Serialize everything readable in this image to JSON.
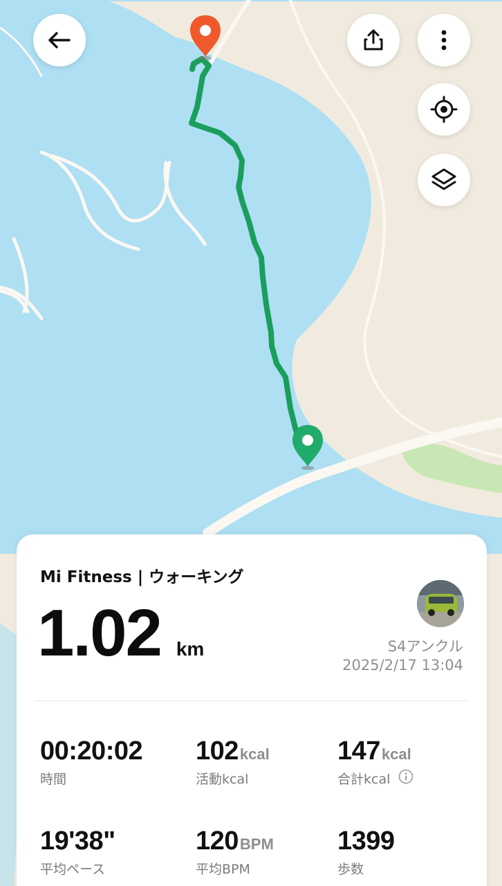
{
  "toolbar": {
    "back": "back-arrow-icon",
    "share": "share-icon",
    "more": "more-vertical-icon",
    "locate": "locate-target-icon",
    "layers": "layers-icon"
  },
  "map": {
    "route_color": "#1a9e5c",
    "start_marker_color": "#1fab6a",
    "end_marker_color": "#f05a2a",
    "water_color": "#aedff3",
    "land_color": "#f1ebdf",
    "park_color": "#c9e7b4"
  },
  "activity": {
    "title": "Mi Fitness | ウォーキング",
    "distance": "1.02",
    "distance_unit": "km",
    "device": "S4アンクル",
    "date": "2025/2/17 13:04"
  },
  "stats": [
    {
      "value": "00:20:02",
      "unit": "",
      "label": "時間"
    },
    {
      "value": "102",
      "unit": "kcal",
      "label": "活動kcal"
    },
    {
      "value": "147",
      "unit": "kcal",
      "label": "合計kcal"
    },
    {
      "value": "19'38\"",
      "unit": "",
      "label": "平均ペース"
    },
    {
      "value": "120",
      "unit": "BPM",
      "label": "平均BPM"
    },
    {
      "value": "1399",
      "unit": "",
      "label": "歩数"
    }
  ]
}
